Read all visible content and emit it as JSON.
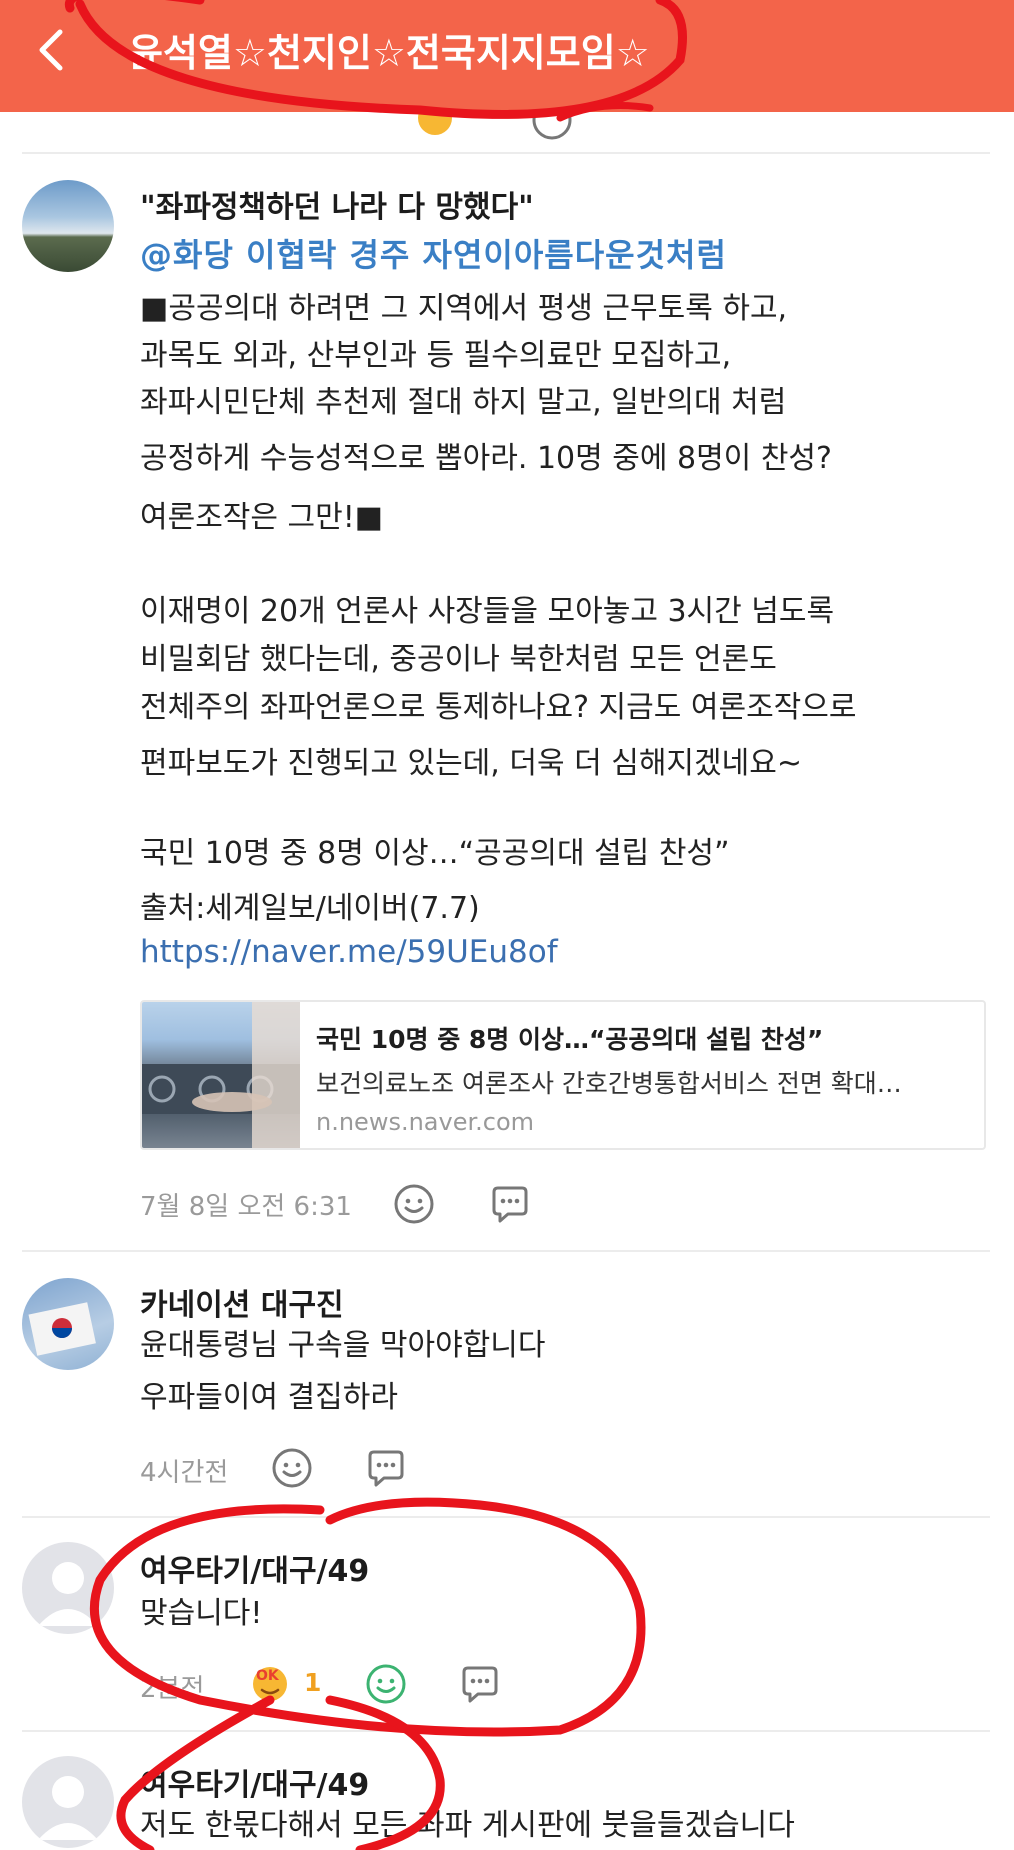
{
  "header": {
    "title": "윤석열☆천지인☆전국지지모임☆",
    "back_icon": "chevron-left-icon",
    "background": "#f3644a"
  },
  "post": {
    "author": "\"좌파정책하던 나라 다 망했다\"",
    "mention": "@화당  이협락  경주    자연이아름다운것처럼",
    "lines": [
      "■공공의대 하려면 그 지역에서 평생 근무토록 하고,",
      "과목도 외과, 산부인과 등 필수의료만 모집하고,",
      "좌파시민단체 추천제 절대 하지 말고, 일반의대 처럼",
      "공정하게 수능성적으로 뽑아라. 10명 중에 8명이 찬성?",
      "여론조작은 그만!■",
      "",
      "이재명이 20개 언론사 사장들을 모아놓고 3시간 넘도록",
      "비밀회담 했다는데, 중공이나 북한처럼 모든 언론도",
      "전체주의 좌파언론으로 통제하나요? 지금도 여론조작으로",
      "편파보도가 진행되고 있는데, 더욱 더 심해지겠네요~",
      "",
      "국민 10명 중 8명 이상…“공공의대 설립 찬성”",
      "출처:세계일보/네이버(7.7)"
    ],
    "link": "https://naver.me/59UEu8of",
    "card": {
      "title": "국민 10명 중 8명 이상…“공공의대 설립 찬성”",
      "description": "보건의료노조 여론조사 간호간병통합서비스 전면 확대…",
      "domain": "n.news.naver.com"
    },
    "timestamp": "7월 8일 오전 6:31"
  },
  "comments": [
    {
      "author": "카네이션 대구진",
      "lines": [
        "윤대통령님 구속을 막아야합니다",
        "우파들이여 결집하라"
      ],
      "timestamp": "4시간전"
    },
    {
      "author": "여우타기/대구/49",
      "lines": [
        "맞습니다!"
      ],
      "timestamp": "2분전",
      "reaction_count": "1"
    },
    {
      "author": "여우타기/대구/49",
      "lines": [
        "저도 한몫다해서 모든 좌파 게시판에 붓을들겠습니다"
      ]
    }
  ],
  "icons": {
    "emoji": "smiley-icon",
    "reply": "speech-bubble-icon",
    "reaction": "ok-emoji-icon"
  },
  "colors": {
    "accent": "#f3644a",
    "mention": "#3a7fc5",
    "annotation": "#e8141c"
  }
}
